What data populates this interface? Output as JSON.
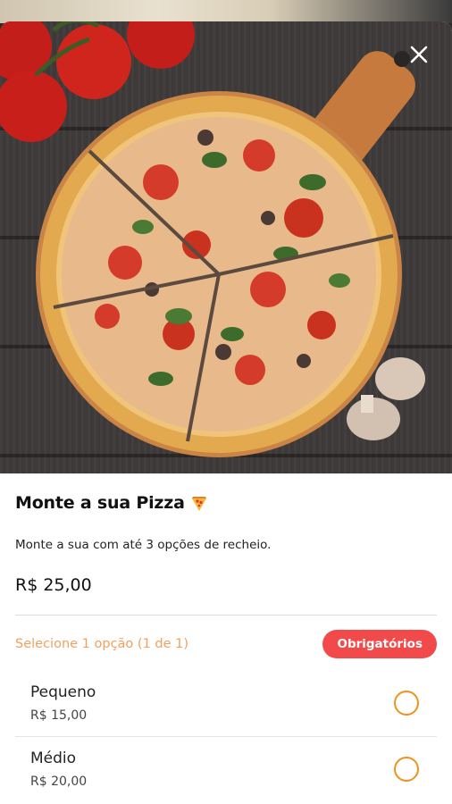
{
  "product": {
    "title": "Monte a sua Pizza",
    "emoji_icon": "pizza-slice-icon",
    "description": "Monte a sua com até 3 opções de recheio.",
    "price": "R$ 25,00"
  },
  "selection": {
    "label": "Selecione 1 opção (1 de 1)",
    "badge": "Obrigatórios"
  },
  "options": [
    {
      "name": "Pequeno",
      "price": "R$ 15,00"
    },
    {
      "name": "Médio",
      "price": "R$ 20,00"
    }
  ],
  "colors": {
    "accent_orange": "#f0921e",
    "label_orange": "#f2a05e",
    "badge_red": "#f2494a"
  }
}
